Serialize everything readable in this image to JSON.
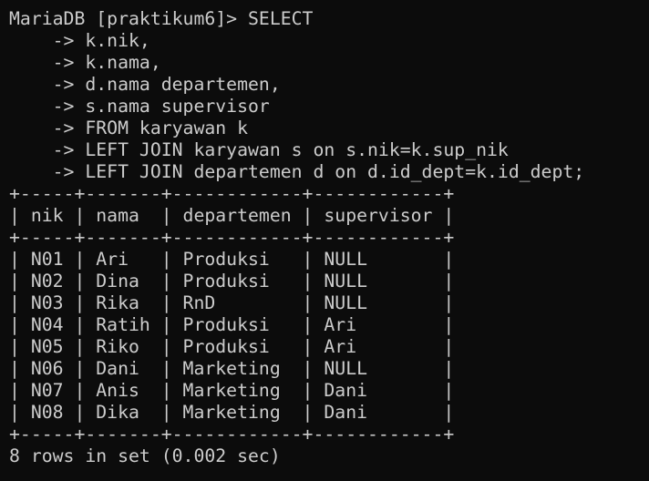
{
  "terminal": {
    "prompt": "MariaDB [praktikum6]> SELECT",
    "query_lines": [
      "    -> k.nik,",
      "    -> k.nama,",
      "    -> d.nama departemen,",
      "    -> s.nama supervisor",
      "    -> FROM karyawan k",
      "    -> LEFT JOIN karyawan s on s.nik=k.sup_nik",
      "    -> LEFT JOIN departemen d on d.id_dept=k.id_dept;"
    ],
    "table": {
      "border": "+-----+-------+------------+------------+",
      "header": "| nik | nama  | departemen | supervisor |",
      "rows": [
        "| N01 | Ari   | Produksi   | NULL       |",
        "| N02 | Dina  | Produksi   | NULL       |",
        "| N03 | Rika  | RnD        | NULL       |",
        "| N04 | Ratih | Produksi   | Ari        |",
        "| N05 | Riko  | Produksi   | Ari        |",
        "| N06 | Dani  | Marketing  | NULL       |",
        "| N07 | Anis  | Marketing  | Dani       |",
        "| N08 | Dika  | Marketing  | Dani       |"
      ]
    },
    "footer": "8 rows in set (0.002 sec)",
    "colors": {
      "background": "#0c0c0c",
      "text": "#cccccc"
    }
  }
}
